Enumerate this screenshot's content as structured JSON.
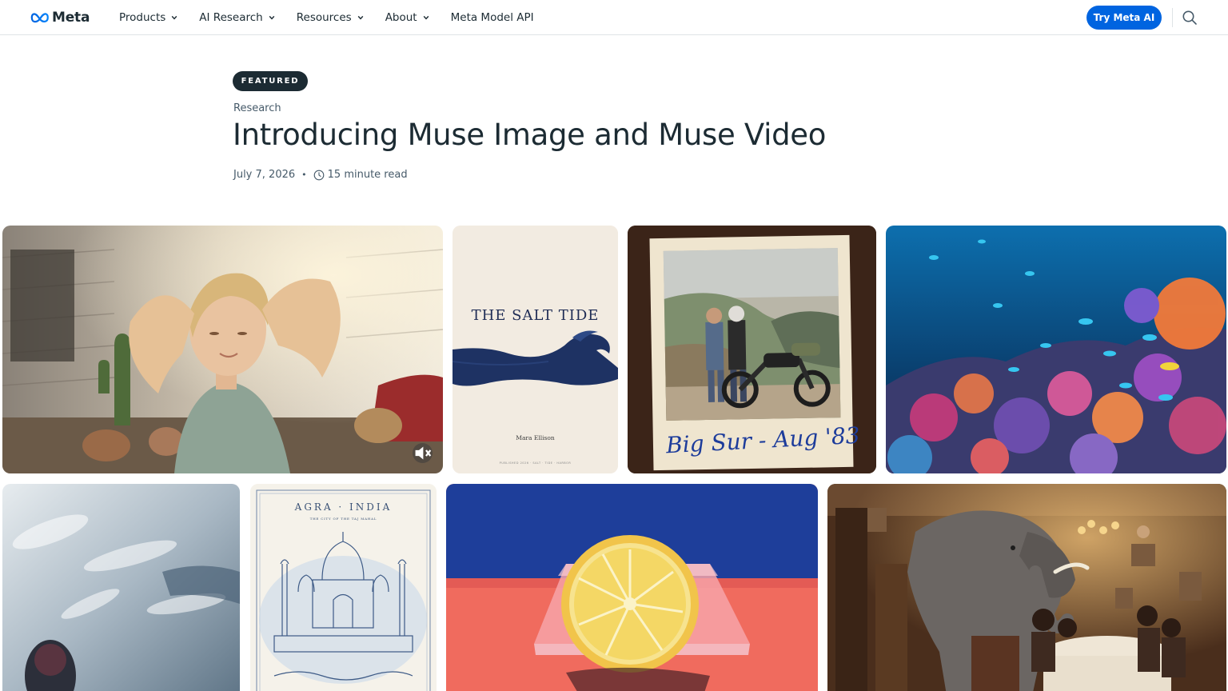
{
  "header": {
    "logo_text": "Meta",
    "nav": [
      {
        "label": "Products"
      },
      {
        "label": "AI Research"
      },
      {
        "label": "Resources"
      },
      {
        "label": "About"
      },
      {
        "label": "Meta Model API"
      }
    ],
    "cta_label": "Try Meta AI",
    "icons": {
      "logo": "meta-infinity-logo",
      "search": "search-icon",
      "dropdown": "chevron-down-icon"
    },
    "accent_color": "#0064e0"
  },
  "article": {
    "badge": "FEATURED",
    "category": "Research",
    "title": "Introducing Muse Image and Muse Video",
    "date": "July 7, 2026",
    "separator": "•",
    "read_time": "15 minute read"
  },
  "gallery": {
    "salt_tide": {
      "title": "THE SALT TIDE",
      "author": "Mara Ellison",
      "fine_print": "PUBLISHED 2026 · SALT · TIDE · HARBOR"
    },
    "polaroid": {
      "caption": "Big Sur - Aug '83"
    },
    "agra": {
      "title": "AGRA · INDIA",
      "subtitle": "THE CITY OF THE TAJ MAHAL"
    },
    "video_control": "mute-icon"
  }
}
